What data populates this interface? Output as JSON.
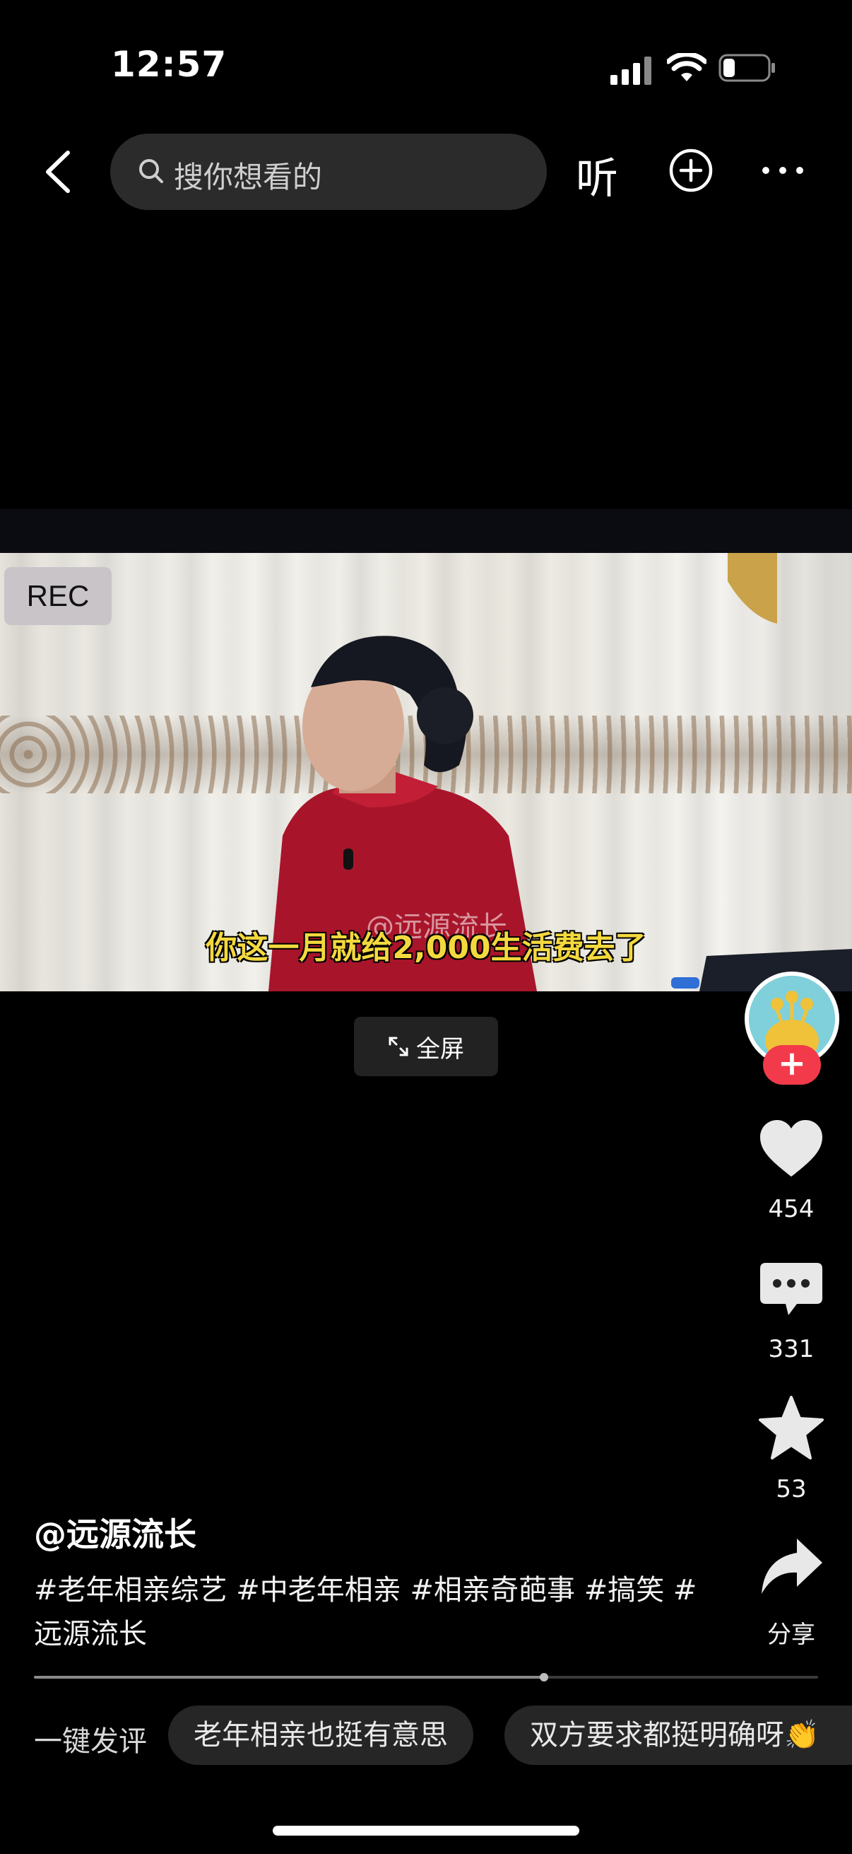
{
  "status_bar": {
    "time": "12:57"
  },
  "nav": {
    "search_placeholder": "搜你想看的",
    "listen_label": "听",
    "icons": [
      "back-icon",
      "search-icon",
      "plus-circle-icon",
      "more-icon"
    ]
  },
  "video": {
    "rec_label": "REC",
    "watermark": "@远源流长",
    "subtitle": "你这一月就给2,000生活费去了",
    "fullscreen_label": "全屏"
  },
  "rail": {
    "follow_label": "+",
    "likes": "454",
    "comments": "331",
    "favorites": "53",
    "share_label": "分享"
  },
  "caption": {
    "author": "@远源流长",
    "tags_line1": "#老年相亲综艺 #中老年相亲 #相亲奇葩事  #搞笑 #",
    "tags_line2": "远源流长"
  },
  "progress": {
    "played_fraction": 0.65
  },
  "quick_comment": {
    "label": "一键发评",
    "chips": [
      "老年相亲也挺有意思",
      "双方要求都挺明确呀👏"
    ]
  },
  "colors": {
    "follow_red": "#f23a4a",
    "subtitle_yellow": "#f4d93e"
  }
}
